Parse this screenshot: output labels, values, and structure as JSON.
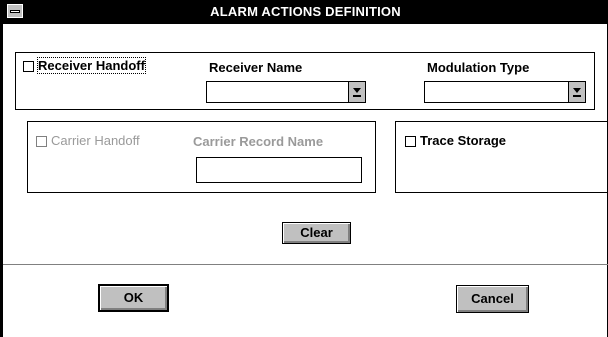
{
  "window": {
    "title": "ALARM ACTIONS DEFINITION"
  },
  "receiver": {
    "handoff_label": "Receiver Handoff",
    "name_label": "Receiver Name",
    "name_value": "",
    "modulation_label": "Modulation Type",
    "modulation_value": ""
  },
  "carrier": {
    "handoff_label": "Carrier Handoff",
    "record_label": "Carrier Record Name",
    "record_value": ""
  },
  "trace": {
    "label": "Trace Storage"
  },
  "buttons": {
    "clear": "Clear",
    "ok": "OK",
    "cancel": "Cancel"
  }
}
